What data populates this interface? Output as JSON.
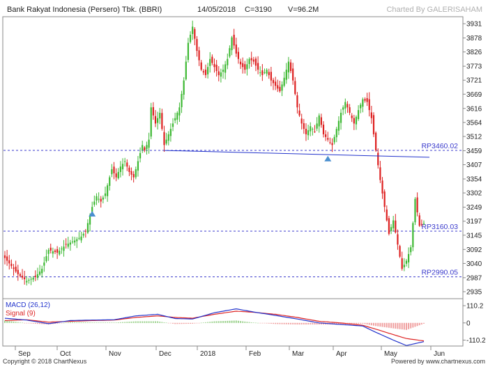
{
  "header": {
    "title": "Bank Rakyat Indonesia (Persero) Tbk. (BBRI)",
    "date": "14/05/2018",
    "close": "C=3190",
    "volume": "V=96.2M",
    "watermark": "Charted By GALERISAHAM"
  },
  "footer": {
    "copyright": "Copyright © 2018 ChartNexus",
    "powered": "Powered by www.chartnexus.com"
  },
  "colors": {
    "up": "#3cb832",
    "down": "#dd1f1f",
    "macd": "#2233cc",
    "signal": "#dd2222",
    "dashed": "#3a3acc",
    "arrow": "#4a8fd0"
  },
  "chart_data": {
    "type": "candlestick",
    "title": "Bank Rakyat Indonesia (Persero) Tbk. (BBRI)",
    "price_axis": {
      "ticks": [
        "3931",
        "3878",
        "3826",
        "3773",
        "3721",
        "3669",
        "3616",
        "3564",
        "3512",
        "3459",
        "3407",
        "3354",
        "3302",
        "3249",
        "3197",
        "3145",
        "3092",
        "3040",
        "2987",
        "2935"
      ],
      "range": [
        2909,
        3957
      ]
    },
    "x_ticks": [
      "Sep",
      "Oct",
      "Nov",
      "Dec",
      "2018",
      "Feb",
      "Mar",
      "Apr",
      "May",
      "Jun"
    ],
    "reference_lines": [
      {
        "label": "RP3460.02",
        "value": 3460.02
      },
      {
        "label": "RP3160.03",
        "value": 3160.03
      },
      {
        "label": "RP2990.05",
        "value": 2990.05
      }
    ],
    "trendline": {
      "from": [
        73,
        3460
      ],
      "to": [
        215,
        3445
      ]
    },
    "arrows": [
      [
        40,
        3235
      ],
      [
        148,
        3440
      ]
    ],
    "close_anchors": [
      [
        0,
        3060
      ],
      [
        3,
        3030
      ],
      [
        6,
        3000
      ],
      [
        10,
        2975
      ],
      [
        14,
        2990
      ],
      [
        17,
        3020
      ],
      [
        20,
        3090
      ],
      [
        24,
        3080
      ],
      [
        28,
        3110
      ],
      [
        32,
        3125
      ],
      [
        35,
        3140
      ],
      [
        37,
        3160
      ],
      [
        40,
        3250
      ],
      [
        42,
        3290
      ],
      [
        44,
        3270
      ],
      [
        46,
        3300
      ],
      [
        49,
        3390
      ],
      [
        51,
        3360
      ],
      [
        53,
        3400
      ],
      [
        55,
        3420
      ],
      [
        57,
        3380
      ],
      [
        59,
        3360
      ],
      [
        61,
        3420
      ],
      [
        63,
        3480
      ],
      [
        64,
        3460
      ],
      [
        66,
        3500
      ],
      [
        67,
        3620
      ],
      [
        69,
        3560
      ],
      [
        71,
        3600
      ],
      [
        73,
        3480
      ],
      [
        74,
        3500
      ],
      [
        76,
        3540
      ],
      [
        78,
        3580
      ],
      [
        80,
        3620
      ],
      [
        82,
        3720
      ],
      [
        84,
        3860
      ],
      [
        86,
        3920
      ],
      [
        88,
        3830
      ],
      [
        90,
        3760
      ],
      [
        92,
        3740
      ],
      [
        94,
        3800
      ],
      [
        96,
        3770
      ],
      [
        98,
        3740
      ],
      [
        100,
        3760
      ],
      [
        102,
        3800
      ],
      [
        104,
        3880
      ],
      [
        106,
        3820
      ],
      [
        108,
        3780
      ],
      [
        110,
        3760
      ],
      [
        112,
        3800
      ],
      [
        114,
        3790
      ],
      [
        116,
        3760
      ],
      [
        118,
        3740
      ],
      [
        120,
        3760
      ],
      [
        122,
        3720
      ],
      [
        124,
        3700
      ],
      [
        126,
        3680
      ],
      [
        128,
        3730
      ],
      [
        130,
        3790
      ],
      [
        132,
        3720
      ],
      [
        134,
        3620
      ],
      [
        136,
        3560
      ],
      [
        138,
        3520
      ],
      [
        140,
        3550
      ],
      [
        142,
        3530
      ],
      [
        144,
        3590
      ],
      [
        146,
        3520
      ],
      [
        148,
        3500
      ],
      [
        150,
        3480
      ],
      [
        152,
        3540
      ],
      [
        154,
        3600
      ],
      [
        156,
        3640
      ],
      [
        158,
        3600
      ],
      [
        160,
        3560
      ],
      [
        162,
        3610
      ],
      [
        164,
        3650
      ],
      [
        166,
        3640
      ],
      [
        168,
        3580
      ],
      [
        170,
        3460
      ],
      [
        172,
        3350
      ],
      [
        174,
        3250
      ],
      [
        176,
        3150
      ],
      [
        178,
        3200
      ],
      [
        180,
        3110
      ],
      [
        182,
        3020
      ],
      [
        184,
        3050
      ],
      [
        186,
        3100
      ],
      [
        188,
        3280
      ],
      [
        190,
        3180
      ],
      [
        192,
        3190
      ]
    ],
    "macd_axis": {
      "ticks": [
        "110.2",
        "0",
        "-110.2"
      ],
      "range": [
        -148,
        155
      ]
    },
    "macd": {
      "name": "MACD (26,12)",
      "anchors": [
        [
          0,
          30
        ],
        [
          10,
          18
        ],
        [
          20,
          -5
        ],
        [
          30,
          15
        ],
        [
          40,
          18
        ],
        [
          50,
          20
        ],
        [
          60,
          45
        ],
        [
          70,
          55
        ],
        [
          78,
          28
        ],
        [
          86,
          25
        ],
        [
          96,
          65
        ],
        [
          106,
          90
        ],
        [
          114,
          70
        ],
        [
          124,
          48
        ],
        [
          134,
          25
        ],
        [
          144,
          0
        ],
        [
          154,
          -10
        ],
        [
          164,
          -20
        ],
        [
          170,
          -60
        ],
        [
          178,
          -110
        ],
        [
          184,
          -145
        ],
        [
          192,
          -120
        ]
      ]
    },
    "signal": {
      "name": "Signal (9)",
      "anchors": [
        [
          0,
          15
        ],
        [
          10,
          20
        ],
        [
          20,
          5
        ],
        [
          30,
          10
        ],
        [
          40,
          15
        ],
        [
          50,
          18
        ],
        [
          60,
          35
        ],
        [
          70,
          45
        ],
        [
          78,
          35
        ],
        [
          86,
          30
        ],
        [
          96,
          55
        ],
        [
          106,
          75
        ],
        [
          114,
          68
        ],
        [
          124,
          55
        ],
        [
          134,
          35
        ],
        [
          144,
          10
        ],
        [
          154,
          0
        ],
        [
          164,
          -15
        ],
        [
          170,
          -40
        ],
        [
          178,
          -75
        ],
        [
          184,
          -100
        ],
        [
          192,
          -115
        ]
      ]
    }
  }
}
